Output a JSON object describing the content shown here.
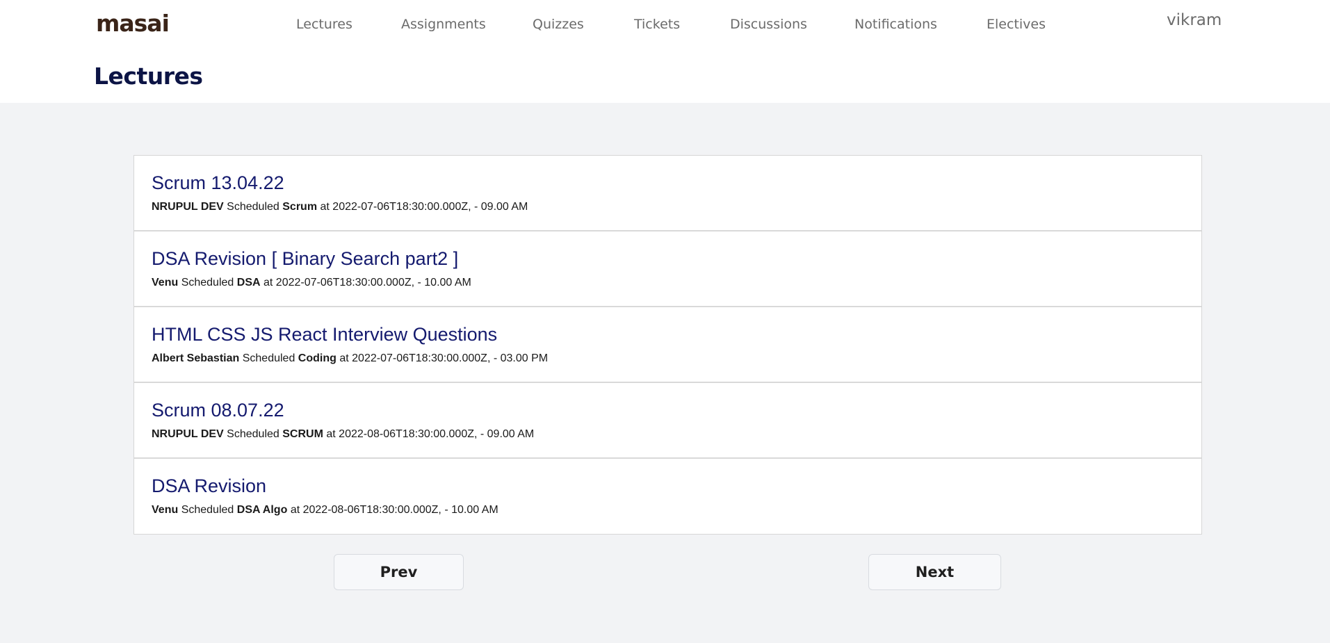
{
  "header": {
    "logo_text": "masai",
    "brand_colors": {
      "logo": "#3a2418",
      "logo_dot": "#e0302a"
    },
    "nav": [
      {
        "label": "Lectures"
      },
      {
        "label": "Assignments"
      },
      {
        "label": "Quizzes"
      },
      {
        "label": "Tickets"
      },
      {
        "label": "Discussions"
      },
      {
        "label": "Notifications"
      },
      {
        "label": "Electives"
      }
    ],
    "user_name": "vikram"
  },
  "page": {
    "title": "Lectures"
  },
  "lectures": [
    {
      "title": "Scrum 13.04.22",
      "instructor": "NRUPUL DEV",
      "scheduled_word": "Scheduled",
      "category": "Scrum",
      "at_word": "at",
      "timestamp": "2022-07-06T18:30:00.000Z, - 09.00 AM"
    },
    {
      "title": "DSA Revision [ Binary Search part2 ]",
      "instructor": "Venu",
      "scheduled_word": "Scheduled",
      "category": "DSA",
      "at_word": "at",
      "timestamp": "2022-07-06T18:30:00.000Z, - 10.00 AM"
    },
    {
      "title": "HTML CSS JS React Interview Questions",
      "instructor": "Albert Sebastian",
      "scheduled_word": "Scheduled",
      "category": "Coding",
      "at_word": "at",
      "timestamp": "2022-07-06T18:30:00.000Z, - 03.00 PM"
    },
    {
      "title": "Scrum 08.07.22",
      "instructor": "NRUPUL DEV",
      "scheduled_word": "Scheduled",
      "category": "SCRUM",
      "at_word": "at",
      "timestamp": "2022-08-06T18:30:00.000Z, - 09.00 AM"
    },
    {
      "title": "DSA Revision",
      "instructor": "Venu",
      "scheduled_word": "Scheduled",
      "category": "DSA Algo",
      "at_word": "at",
      "timestamp": "2022-08-06T18:30:00.000Z, - 10.00 AM"
    }
  ],
  "pagination": {
    "prev_label": "Prev",
    "next_label": "Next"
  }
}
